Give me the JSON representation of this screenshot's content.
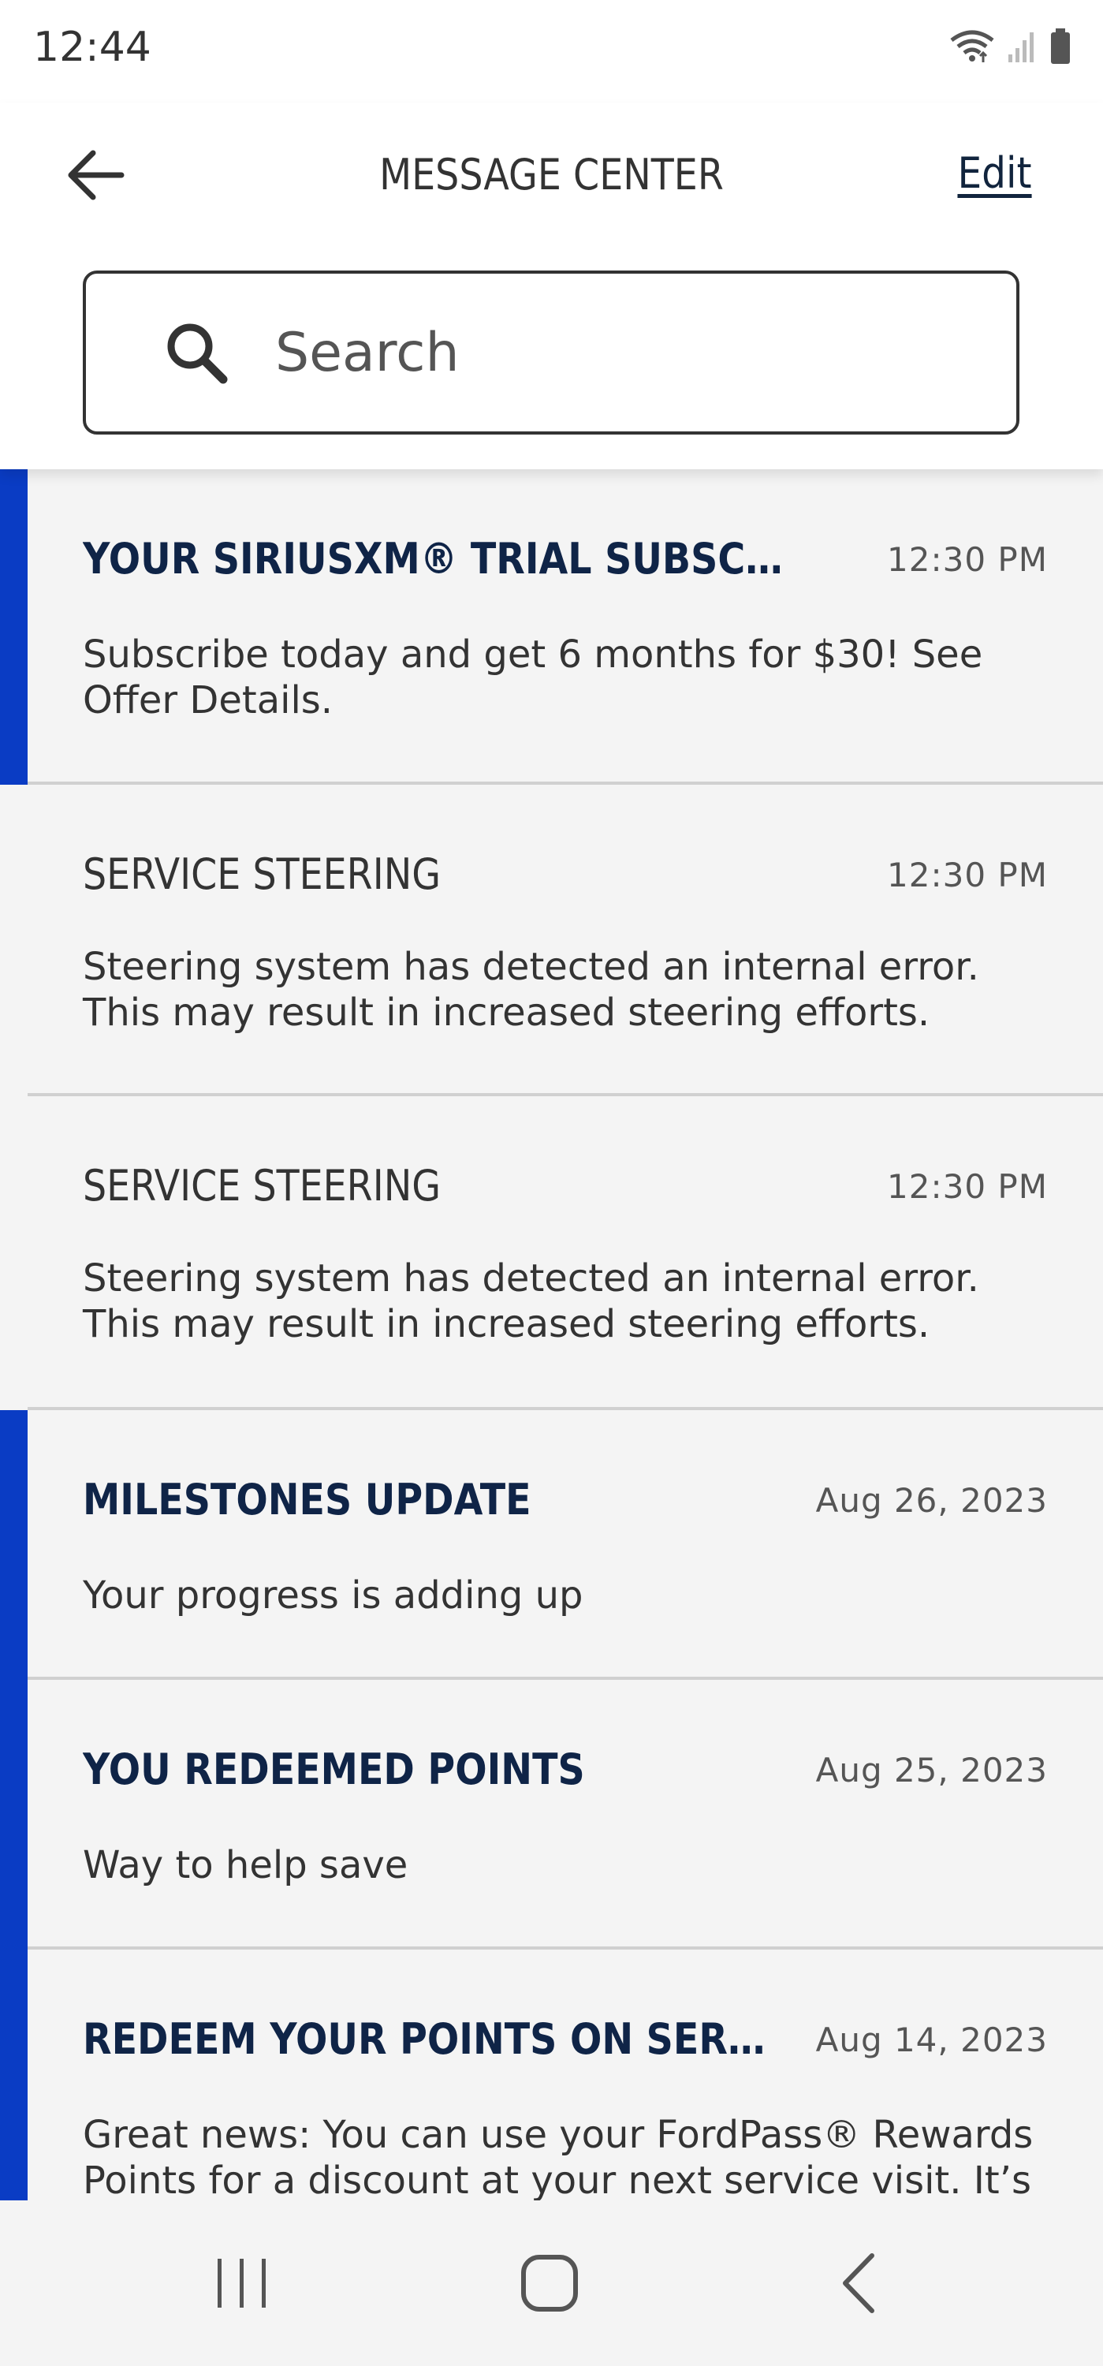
{
  "status_bar": {
    "time": "12:44",
    "icons": [
      "wifi-icon",
      "signal-icon",
      "battery-icon"
    ]
  },
  "header": {
    "title": "MESSAGE CENTER",
    "edit_label": "Edit",
    "back_icon": "arrow-left-icon"
  },
  "search": {
    "placeholder": "Search",
    "value": ""
  },
  "messages": [
    {
      "title": "YOUR SIRIUSXM® TRIAL SUBSCRIPTIO...",
      "date": "12:30 PM",
      "body": "Subscribe today and get 6 months for $30! See Offer Details.",
      "unread": true
    },
    {
      "title": "SERVICE STEERING",
      "date": "12:30 PM",
      "body": "Steering system has detected an internal error.  This may result in increased steering efforts.",
      "unread": false
    },
    {
      "title": "SERVICE STEERING",
      "date": "12:30 PM",
      "body": "Steering system has detected an internal error.  This may result in increased steering efforts.",
      "unread": false
    },
    {
      "title": "MILESTONES UPDATE",
      "date": "Aug 26, 2023",
      "body": "Your progress is adding up",
      "unread": true
    },
    {
      "title": "YOU REDEEMED POINTS",
      "date": "Aug 25, 2023",
      "body": "Way to help save",
      "unread": true
    },
    {
      "title": "REDEEM YOUR POINTS ON SERVICE.",
      "date": "Aug 14, 2023",
      "body": "Great news: You can use your FordPass® Rewards Points for a discount at your next service visit. It’s a...",
      "unread": true
    }
  ],
  "colors": {
    "unread_accent": "#0a3cc4",
    "unread_title": "#0f2447",
    "background": "#f4f4f4"
  },
  "nav_bar": {
    "icons": [
      "recent-apps-icon",
      "home-icon",
      "back-nav-icon"
    ]
  }
}
